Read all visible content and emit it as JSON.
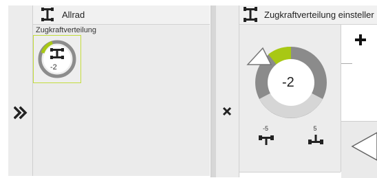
{
  "left_panel": {
    "title": "Allrad",
    "subtitle": "Zugkraftverteilung",
    "thumbnail": {
      "value_label": "-2"
    },
    "expand_icon": "double-chevron-right-icon"
  },
  "right_panel": {
    "title": "Zugkraftverteilung einsteller",
    "close_icon": "close-icon",
    "gauge": {
      "value_label": "-2",
      "min_label": "-5",
      "max_label": "5"
    },
    "plus_icon": "plus-icon",
    "back_icon": "triangle-left-icon"
  },
  "colors": {
    "accent": "#a8c814",
    "gauge_dark": "#8a8a8a",
    "gauge_light": "#d6d6d6",
    "panel_bg": "#ececec"
  }
}
